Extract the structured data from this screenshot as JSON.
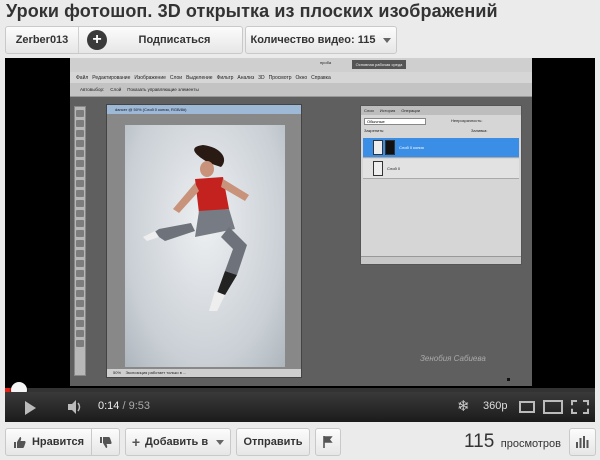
{
  "title": "Уроки фотошоп. 3D открытка из плоских изображений",
  "channel": {
    "name": "Zerber013",
    "subscribe_label": "Подписаться"
  },
  "video_count": "Количество видео: 115",
  "player": {
    "current_time": "0:14",
    "duration": "/ 9:53",
    "quality": "360p",
    "progress_fraction": 0.0236,
    "screen": {
      "menu": [
        "Файл",
        "Редактирование",
        "Изображение",
        "Слои",
        "Выделение",
        "Фильтр",
        "Анализ",
        "3D",
        "Просмотр",
        "Окно",
        "Справка"
      ],
      "workspace_label": "Основная рабочая среда",
      "workspace_small": "проба",
      "options_autoselect": "Автовыбор:",
      "options_layer": "Слой",
      "options_show": "Показать управляющие элементы",
      "doc_title": "dancer @ 50% (Слой 0 копия, RGB/8#)",
      "doc_zoom": "50%",
      "doc_status": "Экспозиция работает только в ...",
      "layers_tabs": [
        "Слои",
        "История",
        "Операции"
      ],
      "blend_mode": "Обычные",
      "opacity_label": "Непрозрачность:",
      "lock_label": "Закрепить:",
      "fill_label": "Заливка:",
      "layer_names": [
        "Слой 0 копия",
        "Слой 0"
      ],
      "watermark": "Зенобия Сабиева"
    }
  },
  "actions": {
    "like_label": "Нравится",
    "add_label": "Добавить в",
    "share_label": "Отправить",
    "views_count": "115",
    "views_label": "просмотров"
  },
  "colors": {
    "progress": "#e62117",
    "selected_layer": "#3a8ee6",
    "background": "#ebebeb"
  }
}
